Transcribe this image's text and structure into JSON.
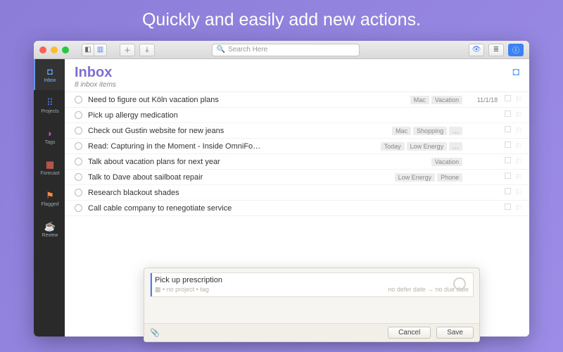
{
  "heading": "Quickly and easily add new actions.",
  "toolbar": {
    "search_placeholder": "Search Here"
  },
  "sidebar": {
    "items": [
      {
        "label": "Inbox"
      },
      {
        "label": "Projects"
      },
      {
        "label": "Tags"
      },
      {
        "label": "Forecast"
      },
      {
        "label": "Flagged"
      },
      {
        "label": "Review"
      }
    ]
  },
  "header": {
    "title": "Inbox",
    "subtitle": "8 inbox items"
  },
  "rows": [
    {
      "title": "Need to figure out Köln vacation plans",
      "tags": [
        "Mac",
        "Vacation"
      ],
      "date": "11/1/18"
    },
    {
      "title": "Pick up allergy medication",
      "tags": [],
      "date": ""
    },
    {
      "title": "Check out Gustin website for new jeans",
      "tags": [
        "Mac",
        "Shopping",
        "…"
      ],
      "date": ""
    },
    {
      "title": "Read: Capturing in the Moment - Inside OmniFo…",
      "tags": [
        "Today",
        "Low Energy",
        "…"
      ],
      "date": ""
    },
    {
      "title": "Talk about vacation plans for next year",
      "tags": [
        "Vacation"
      ],
      "date": ""
    },
    {
      "title": "Talk to Dave about sailboat repair",
      "tags": [
        "Low Energy",
        "Phone"
      ],
      "date": ""
    },
    {
      "title": "Research blackout shades",
      "tags": [],
      "date": ""
    },
    {
      "title": "Call cable company to renegotiate service",
      "tags": [],
      "date": ""
    }
  ],
  "quick_entry": {
    "title": "Pick up prescription",
    "meta_left": "▦ • no project • tag",
    "meta_right": "no defer date → no due date",
    "cancel": "Cancel",
    "save": "Save"
  }
}
